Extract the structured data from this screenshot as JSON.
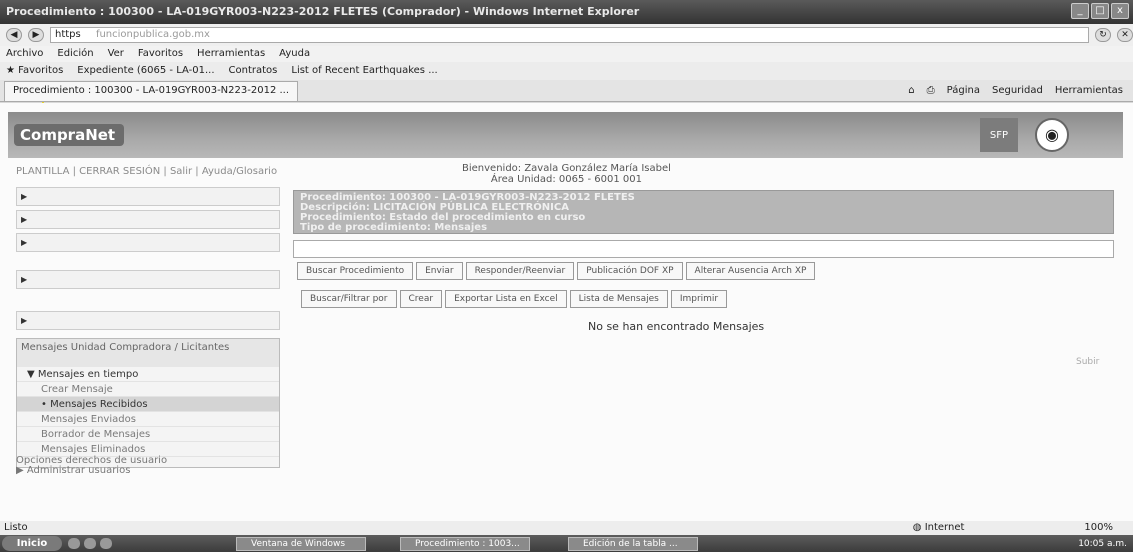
{
  "browser": {
    "window_title": "Procedimiento : 100300 - LA-019GYR003-N223-2012 FLETES (Comprador) - Windows Internet Explorer",
    "url_prefix": "https",
    "url_domain": "funcionpublica.gob.mx",
    "menu": [
      "Archivo",
      "Edición",
      "Ver",
      "Favoritos",
      "Herramientas",
      "Ayuda"
    ],
    "favorites": [
      "Favoritos",
      "Expediente (6065 - LA-01...",
      "Contratos",
      "List of Recent Earthquakes ..."
    ],
    "tab_label": "Procedimiento : 100300 - LA-019GYR003-N223-2012 ...",
    "commands": [
      "Página",
      "Seguridad",
      "Herramientas"
    ],
    "window_buttons": [
      "_",
      "□",
      "x"
    ]
  },
  "site": {
    "logo": "CompraNet",
    "sfp_label": "SFP",
    "breadcrumbs": "PLANTILLA | CERRAR SESIÓN | Salir | Ayuda/Glosario",
    "user_line1": "Bienvenido: Zavala González María Isabel",
    "user_line2": "Área Unidad: 0065 - 6001 001"
  },
  "left_boxes": [
    "",
    "",
    "",
    "",
    ""
  ],
  "messages_panel": {
    "title": "Mensajes Unidad Compradora / Licitantes",
    "folder": "Mensajes en tiempo",
    "items": [
      "Crear Mensaje",
      "Mensajes Recibidos",
      "Mensajes Enviados",
      "Borrador de Mensajes",
      "Mensajes Eliminados"
    ]
  },
  "preferences": {
    "title": "Opciones derechos de usuario",
    "item": "Administrar usuarios"
  },
  "procedure": {
    "line1": "Procedimiento: 100300 - LA-019GYR003-N223-2012 FLETES",
    "line2": "Descripción: LICITACIÓN PÚBLICA ELECTRÓNICA",
    "line3": "Procedimiento: Estado del procedimiento en curso",
    "line4": "Tipo de procedimiento: Mensajes"
  },
  "toolbar1": [
    "Buscar Procedimiento",
    "Enviar",
    "Responder/Reenviar",
    "Publicación DOF XP",
    "Alterar Ausencia Arch XP"
  ],
  "toolbar2": [
    "Buscar/Filtrar por",
    "Crear",
    "Exportar Lista en Excel",
    "Lista de Mensajes",
    "Imprimir"
  ],
  "no_results": "No se han encontrado Mensajes",
  "subir": "Subir",
  "status": {
    "left": "Listo",
    "zone": "Internet",
    "zoom": "100%"
  },
  "taskbar": {
    "start": "Inicio",
    "items": [
      "Ventana de Windows",
      "Procedimiento : 1003...",
      "Edición de la tabla ..."
    ],
    "clock": "10:05 a.m."
  }
}
